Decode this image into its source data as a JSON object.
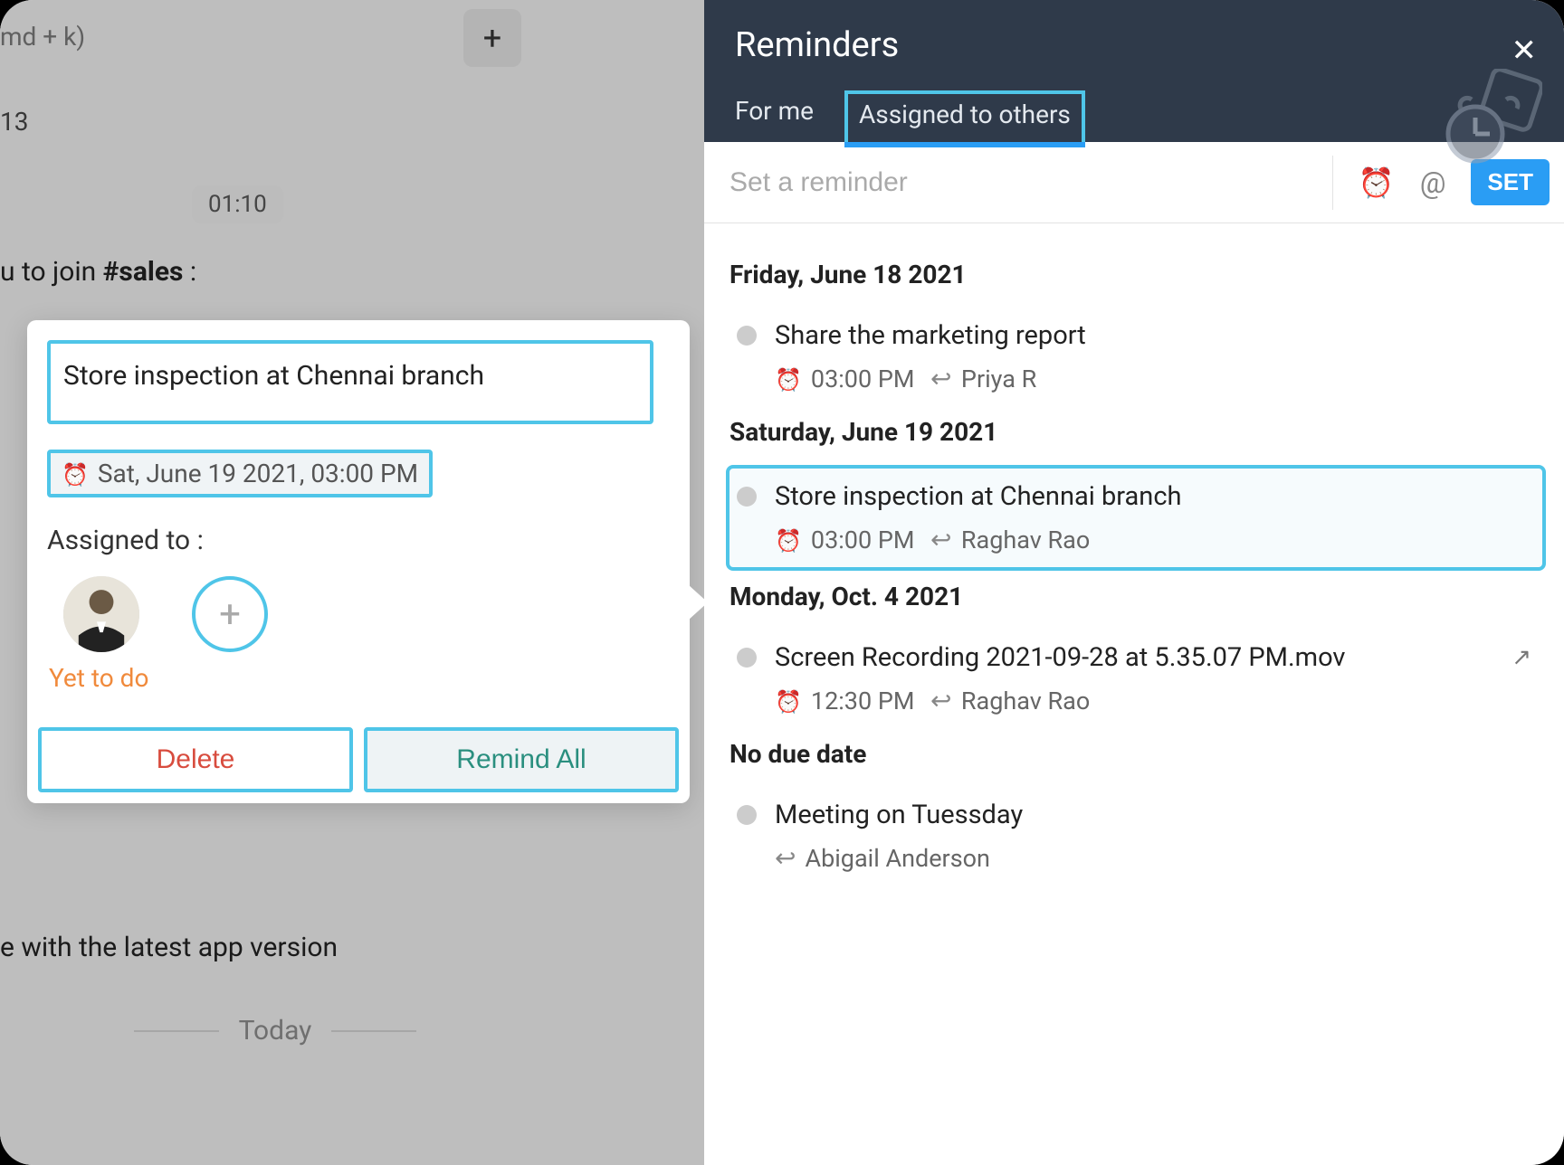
{
  "leftBackground": {
    "searchHint": "md + k)",
    "line13": "13",
    "timeBadge": "01:10",
    "joinPrefix": "u to join ",
    "joinChannel": "#sales",
    "joinSuffix": " :",
    "appVersionLine": "e with the latest app version",
    "todayLabel": "Today"
  },
  "popup": {
    "title": "Store inspection at Chennai branch",
    "dateLabel": "Sat, June 19 2021, 03:00 PM",
    "assignedLabel": "Assigned to :",
    "statusLabel": "Yet to do",
    "deleteLabel": "Delete",
    "remindLabel": "Remind All"
  },
  "panel": {
    "title": "Reminders",
    "tabs": {
      "forMe": "For me",
      "assigned": "Assigned to others"
    },
    "inputPlaceholder": "Set a reminder",
    "setLabel": "SET",
    "groups": [
      {
        "header": "Friday, June 18 2021",
        "items": [
          {
            "title": "Share the marketing report",
            "time": "03:00 PM",
            "person": "Priya R",
            "selected": false,
            "external": false
          }
        ]
      },
      {
        "header": "Saturday, June 19 2021",
        "items": [
          {
            "title": "Store inspection at Chennai branch",
            "time": "03:00 PM",
            "person": "Raghav Rao",
            "selected": true,
            "external": false
          }
        ]
      },
      {
        "header": "Monday, Oct. 4 2021",
        "items": [
          {
            "title": "Screen Recording 2021-09-28 at 5.35.07 PM.mov",
            "time": "12:30 PM",
            "person": "Raghav Rao",
            "selected": false,
            "external": true
          }
        ]
      },
      {
        "header": "No due date",
        "items": [
          {
            "title": "Meeting on Tuessday",
            "time": "",
            "person": "Abigail Anderson",
            "selected": false,
            "external": false
          }
        ]
      }
    ]
  }
}
